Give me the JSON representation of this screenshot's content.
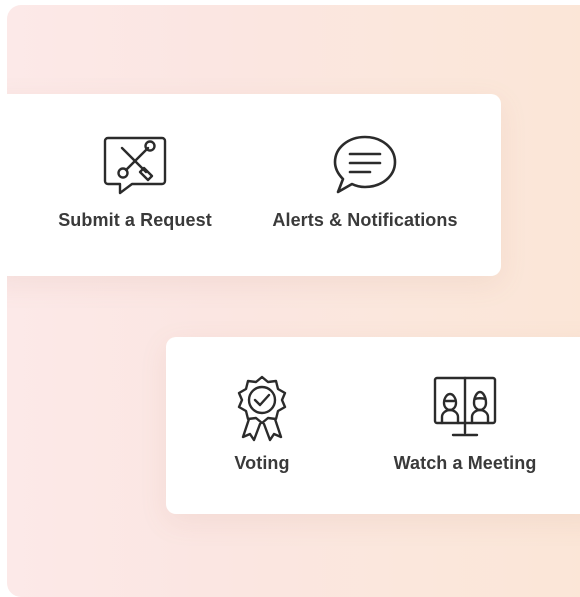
{
  "services": {
    "top": [
      {
        "label": "Submit a Request",
        "icon": "wrench-screwdriver-chat-icon"
      },
      {
        "label": "Alerts & Notifications",
        "icon": "speech-bubble-icon"
      }
    ],
    "bottom": [
      {
        "label": "Voting",
        "icon": "award-badge-check-icon"
      },
      {
        "label": "Watch a Meeting",
        "icon": "video-meeting-icon"
      }
    ]
  },
  "colors": {
    "background_left": "#fce9e8",
    "background_right": "#fbe6d7",
    "card": "#ffffff",
    "icon_stroke": "#2b2b2b",
    "label": "#3a3a3a"
  }
}
